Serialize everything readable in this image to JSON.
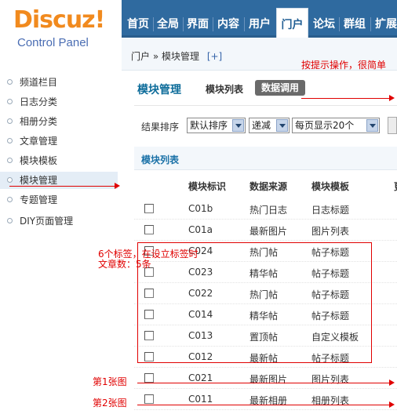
{
  "logo": {
    "title": "Discuz!",
    "subtitle": "Control Panel"
  },
  "topnav": {
    "tabs": [
      {
        "label": "首页"
      },
      {
        "label": "全局"
      },
      {
        "label": "界面"
      },
      {
        "label": "内容"
      },
      {
        "label": "用户"
      },
      {
        "label": "门户",
        "active": true
      },
      {
        "label": "论坛"
      },
      {
        "label": "群组"
      },
      {
        "label": "扩展"
      }
    ]
  },
  "sidebar": {
    "items": [
      {
        "label": "频道栏目"
      },
      {
        "label": "日志分类"
      },
      {
        "label": "相册分类"
      },
      {
        "label": "文章管理"
      },
      {
        "label": "模块模板"
      },
      {
        "label": "模块管理",
        "active": true
      },
      {
        "label": "专题管理"
      },
      {
        "label": "DIY页面管理"
      }
    ]
  },
  "breadcrumb": {
    "path": "门户 » 模块管理",
    "add": "[+]"
  },
  "section": {
    "title": "模块管理",
    "tab_list": "模块列表",
    "tab_data": "数据调用"
  },
  "filters": {
    "label": "结果排序",
    "order_by": "默认排序",
    "direction": "递减",
    "per_page": "每页显示20个"
  },
  "list": {
    "title": "模块列表",
    "columns": [
      "模块标识",
      "数据来源",
      "模块模板",
      "更"
    ],
    "rows": [
      {
        "id": "C01b",
        "source": "热门日志",
        "template": "日志标题"
      },
      {
        "id": "C01a",
        "source": "最新图片",
        "template": "图片列表"
      },
      {
        "id": "C024",
        "source": "热门帖",
        "template": "帖子标题"
      },
      {
        "id": "C023",
        "source": "精华帖",
        "template": "帖子标题"
      },
      {
        "id": "C022",
        "source": "热门帖",
        "template": "帖子标题"
      },
      {
        "id": "C014",
        "source": "精华帖",
        "template": "帖子标题"
      },
      {
        "id": "C013",
        "source": "置顶帖",
        "template": "自定义模板"
      },
      {
        "id": "C012",
        "source": "最新帖",
        "template": "帖子标题"
      },
      {
        "id": "C021",
        "source": "最新图片",
        "template": "图片列表"
      },
      {
        "id": "C011",
        "source": "最新相册",
        "template": "相册列表"
      }
    ]
  },
  "annotations": {
    "hint": "按提示操作，很简单",
    "note_line1": "6个标签，在设立标签时",
    "note_line2": "文章数：5条",
    "pic1": "第1张图",
    "pic2": "第2张图"
  },
  "colors": {
    "nav_bg": "#2f6a9f",
    "accent": "#0d6c9a",
    "logo_orange": "#f18a1e",
    "annotation_red": "#e00000"
  }
}
